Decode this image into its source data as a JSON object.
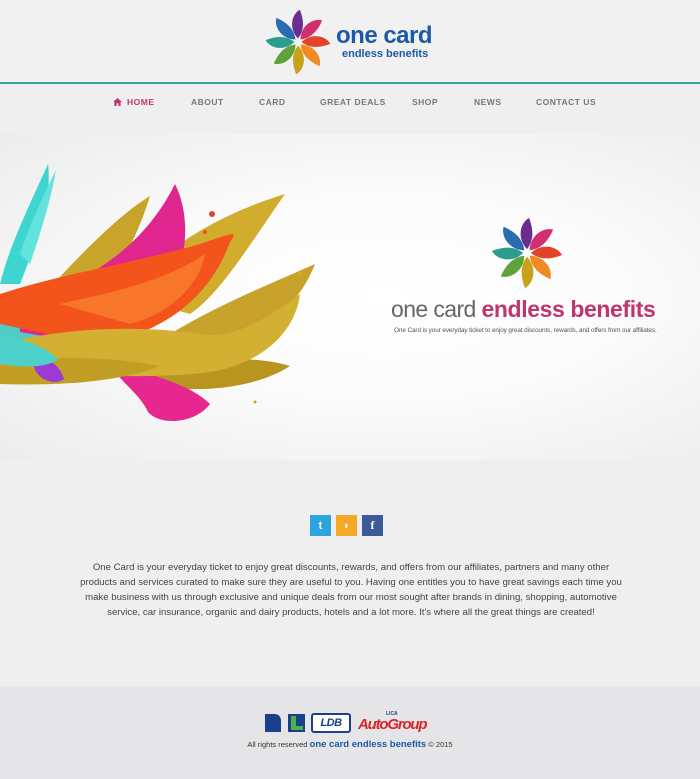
{
  "brand": {
    "name": "one card",
    "tagline": "endless benefits",
    "colors": {
      "primary_blue": "#1b5aa6",
      "accent_pink": "#c0356f",
      "header_rule": "#3aa1a4"
    }
  },
  "nav": {
    "items": [
      {
        "label": "HOME",
        "icon": "home-icon",
        "active": true
      },
      {
        "label": "ABOUT"
      },
      {
        "label": "CARD"
      },
      {
        "label": "GREAT DEALS"
      },
      {
        "label": "SHOP"
      },
      {
        "label": "NEWS"
      },
      {
        "label": "CONTACT US"
      }
    ]
  },
  "hero": {
    "title_part1": "one card",
    "title_part2": "endless benefits",
    "subtitle": "One Card is your everyday ticket to enjoy great discounts, rewards, and offers from our affiliates."
  },
  "social": [
    {
      "name": "twitter",
      "glyph": "t",
      "color": "#2aa5df"
    },
    {
      "name": "rss",
      "glyph": "◗",
      "color": "#f3a826"
    },
    {
      "name": "facebook",
      "glyph": "f",
      "color": "#3b5a98"
    }
  ],
  "description": "One Card is your everyday ticket to enjoy great discounts, rewards, and offers from our affiliates, partners and many other products and services curated to make sure they are useful to you. Having one entitles you to have great savings each time you make business with us through exclusive and unique deals from our most sought after brands in dining, shopping, automotive service, car insurance, organic and dairy products, hotels and a lot more. It's where all the great things are created!",
  "footer": {
    "partners": {
      "ldb": "LDB",
      "lica": "LICA",
      "autogroup": "AutoGroup"
    },
    "copyright_prefix": "All rights reserved",
    "copyright_brand": "one card endless benefits",
    "copyright_suffix": "© 2015"
  }
}
